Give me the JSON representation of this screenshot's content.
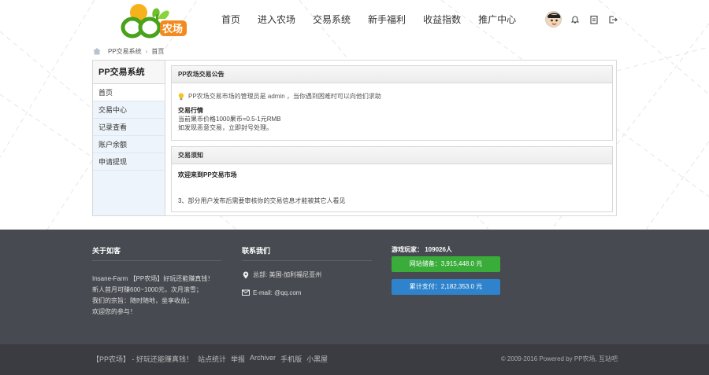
{
  "header": {
    "nav": [
      "首页",
      "进入农场",
      "交易系统",
      "新手福利",
      "收益指数",
      "推广中心"
    ]
  },
  "breadcrumb": {
    "site": "PP交易系统",
    "page": "首页"
  },
  "sidebar": {
    "title": "PP交易系统",
    "items": [
      "首页",
      "交易中心",
      "记录查看",
      "账户余额",
      "申请提现"
    ]
  },
  "announcement": {
    "title": "PP农场交易公告",
    "notice": "PP农场交易市场的管理员是 admin ，当你遇到困难时可以向他们求助",
    "market_title": "交易行情",
    "price": "当前果币价格1000果币=0.5-1元RMB",
    "warning": "如发现恶意交易，立即封号处理。"
  },
  "trade_notice": {
    "title": "交易须知",
    "welcome": "欢迎来到PP交易市场",
    "rule": "3、部分用户发布后需要审核你的交易信息才能被其它人看见"
  },
  "footer": {
    "about_title": "关于如客",
    "about_lines": [
      "Insane-Farm 【PP农场】好玩还能赚真钱！",
      "新人首月可赚600~1000元，次月滚雪；",
      "我们的宗旨：随时随地，坐享收益；",
      "欢迎您的参与！"
    ],
    "contact_title": "联系我们",
    "address": "总部: 美国-加利福尼亚州",
    "email": "E-mail: @qq.com",
    "players": "游戏玩家： 109026人",
    "balance": "网站储备：3,915,448.0 元",
    "paid": "累计支付：2,182,353.0 元"
  },
  "bottom": {
    "links": [
      "【PP农场】 - 好玩还能赚真钱！",
      "站点统计",
      "举报",
      "Archiver",
      "手机版",
      "小黑屋"
    ],
    "copyright": "© 2009-2016  Powered by PP农场, 互站吧"
  },
  "colors": {
    "green": "#3aac3a",
    "blue": "#2f83cc",
    "footer": "#474a50"
  }
}
